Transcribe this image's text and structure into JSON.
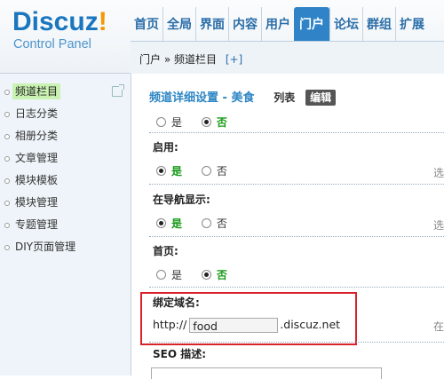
{
  "logo": {
    "main": "Discuz",
    "bang": "!",
    "sub": "Control Panel"
  },
  "topnav": {
    "items": [
      {
        "label": "首页",
        "active": false
      },
      {
        "label": "全局",
        "active": false
      },
      {
        "label": "界面",
        "active": false
      },
      {
        "label": "内容",
        "active": false
      },
      {
        "label": "用户",
        "active": false
      },
      {
        "label": "门户",
        "active": true
      },
      {
        "label": "论坛",
        "active": false
      },
      {
        "label": "群组",
        "active": false
      },
      {
        "label": "扩展",
        "active": false
      }
    ]
  },
  "breadcrumb": {
    "text": "门户 » 频道栏目",
    "add": "[+]"
  },
  "sidebar": {
    "items": [
      {
        "label": "频道栏目",
        "active": true
      },
      {
        "label": "日志分类"
      },
      {
        "label": "相册分类"
      },
      {
        "label": "文章管理"
      },
      {
        "label": "模块模板"
      },
      {
        "label": "模块管理"
      },
      {
        "label": "专题管理"
      },
      {
        "label": "DIY页面管理"
      }
    ]
  },
  "main": {
    "title": "频道详细设置 - 美食",
    "tab_list": "列表",
    "tab_edit": "编辑",
    "row0": {
      "yes": "是",
      "no": "否",
      "selected": "no"
    },
    "enable": {
      "label": "启用:",
      "yes": "是",
      "no": "否",
      "selected": "yes",
      "hint": "选"
    },
    "nav_show": {
      "label": "在导航显示:",
      "yes": "是",
      "no": "否",
      "selected": "yes",
      "hint": "选"
    },
    "homepage": {
      "label": "首页:",
      "yes": "是",
      "no": "否",
      "selected": "no"
    },
    "domain": {
      "label": "绑定域名:",
      "prefix": "http://",
      "value": "food",
      "suffix": ".discuz.net",
      "hint": "在"
    },
    "seo": {
      "label": "SEO 描述:"
    }
  },
  "colors": {
    "accent": "#2f83c6",
    "highlight_box": "#d8232a",
    "active_side": "#c9f2b3"
  }
}
